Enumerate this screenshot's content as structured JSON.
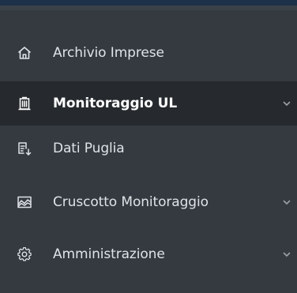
{
  "sidebar": {
    "items": [
      {
        "label": "Archivio Imprese",
        "icon": "home-icon",
        "active": false,
        "expandable": false
      },
      {
        "label": "Monitoraggio UL",
        "icon": "building-icon",
        "active": true,
        "expandable": true
      },
      {
        "label": "Dati Puglia",
        "icon": "data-download-icon",
        "active": false,
        "expandable": false
      },
      {
        "label": "Cruscotto Monitoraggio",
        "icon": "area-chart-icon",
        "active": false,
        "expandable": true
      },
      {
        "label": "Amministrazione",
        "icon": "gear-icon",
        "active": false,
        "expandable": true
      }
    ]
  },
  "colors": {
    "sidebar_bg": "#343a40",
    "active_bg": "#262a2e",
    "top_bar": "#1d3148",
    "text": "#dfe3e7",
    "active_text": "#ffffff"
  }
}
